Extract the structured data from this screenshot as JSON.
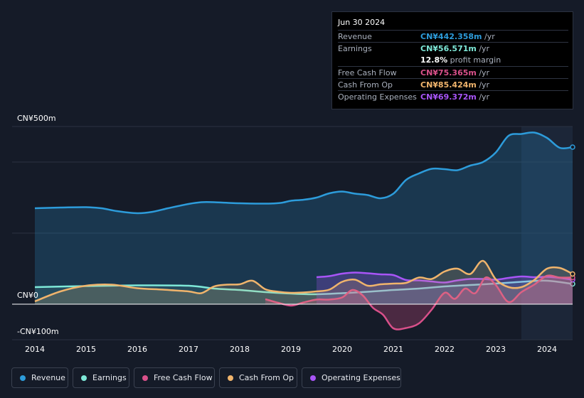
{
  "tooltip": {
    "date": "Jun 30 2024",
    "rows": [
      {
        "label": "Revenue",
        "value": "CN¥442.358m",
        "unit": " /yr",
        "color": "#2d9cdb"
      },
      {
        "label": "Earnings",
        "value": "CN¥56.571m",
        "unit": " /yr",
        "color": "#7ee8d8"
      },
      {
        "label": "",
        "value": "12.8%",
        "unit": " profit margin",
        "color": "#ffffff"
      },
      {
        "label": "Free Cash Flow",
        "value": "CN¥75.365m",
        "unit": " /yr",
        "color": "#d9508a"
      },
      {
        "label": "Cash From Op",
        "value": "CN¥85.424m",
        "unit": " /yr",
        "color": "#f0b46c"
      },
      {
        "label": "Operating Expenses",
        "value": "CN¥69.372m",
        "unit": " /yr",
        "color": "#a855f7"
      }
    ]
  },
  "axis": {
    "y_top_label": "CN¥500m",
    "y_zero_label": "CN¥0",
    "y_bottom_label": "-CN¥100m"
  },
  "legend": [
    {
      "label": "Revenue",
      "color": "#2d9cdb"
    },
    {
      "label": "Earnings",
      "color": "#7ee8d8"
    },
    {
      "label": "Free Cash Flow",
      "color": "#d9508a"
    },
    {
      "label": "Cash From Op",
      "color": "#f0b46c"
    },
    {
      "label": "Operating Expenses",
      "color": "#a855f7"
    }
  ],
  "chart_data": {
    "type": "area",
    "ylim": [
      -100,
      500
    ],
    "xlim": [
      2014.0,
      2024.5
    ],
    "x_ticks": [
      "2014",
      "2015",
      "2016",
      "2017",
      "2018",
      "2019",
      "2020",
      "2021",
      "2022",
      "2023",
      "2024"
    ],
    "highlight_from": 2023.5,
    "series": [
      {
        "name": "Revenue",
        "color": "#2d9cdb",
        "x": [
          2014.0,
          2014.5,
          2015.0,
          2015.3,
          2015.6,
          2016.0,
          2016.3,
          2016.6,
          2017.0,
          2017.25,
          2017.5,
          2018.0,
          2018.5,
          2018.8,
          2019.0,
          2019.25,
          2019.5,
          2019.75,
          2020.0,
          2020.25,
          2020.5,
          2020.75,
          2021.0,
          2021.25,
          2021.5,
          2021.75,
          2022.0,
          2022.25,
          2022.5,
          2022.75,
          2023.0,
          2023.25,
          2023.5,
          2023.75,
          2024.0,
          2024.25,
          2024.5
        ],
        "y": [
          270,
          272,
          273,
          270,
          262,
          256,
          260,
          270,
          282,
          287,
          287,
          284,
          283,
          285,
          291,
          294,
          300,
          312,
          317,
          311,
          307,
          298,
          311,
          350,
          368,
          381,
          380,
          377,
          390,
          400,
          427,
          474,
          479,
          483,
          468,
          440,
          442
        ]
      },
      {
        "name": "Earnings",
        "color": "#7ee8d8",
        "x": [
          2014.0,
          2015.0,
          2016.0,
          2017.0,
          2017.5,
          2018.0,
          2018.5,
          2019.0,
          2019.5,
          2020.0,
          2020.5,
          2021.0,
          2021.5,
          2022.0,
          2022.5,
          2023.0,
          2023.5,
          2024.0,
          2024.5
        ],
        "y": [
          48,
          51,
          53,
          52,
          44,
          40,
          34,
          30,
          28,
          31,
          35,
          40,
          44,
          50,
          54,
          58,
          63,
          66,
          57
        ]
      },
      {
        "name": "Operating Expenses",
        "color": "#a855f7",
        "x": [
          2019.5,
          2019.75,
          2020.0,
          2020.25,
          2020.5,
          2020.75,
          2021.0,
          2021.25,
          2021.5,
          2021.75,
          2022.0,
          2022.25,
          2022.5,
          2022.75,
          2023.0,
          2023.25,
          2023.5,
          2023.75,
          2024.0,
          2024.25,
          2024.5
        ],
        "y": [
          76,
          79,
          86,
          89,
          87,
          84,
          82,
          68,
          67,
          64,
          61,
          67,
          71,
          71,
          69,
          74,
          78,
          76,
          77,
          74,
          69
        ]
      },
      {
        "name": "Free Cash Flow",
        "color": "#d9508a",
        "x": [
          2018.5,
          2018.75,
          2019.0,
          2019.25,
          2019.5,
          2019.75,
          2020.0,
          2020.2,
          2020.4,
          2020.6,
          2020.8,
          2021.0,
          2021.25,
          2021.5,
          2021.75,
          2022.0,
          2022.2,
          2022.4,
          2022.6,
          2022.8,
          2023.0,
          2023.25,
          2023.5,
          2023.75,
          2024.0,
          2024.25,
          2024.5
        ],
        "y": [
          14,
          4,
          -4,
          5,
          13,
          13,
          19,
          40,
          25,
          -10,
          -30,
          -68,
          -67,
          -54,
          -15,
          32,
          15,
          44,
          31,
          75,
          54,
          6,
          34,
          55,
          80,
          75,
          75
        ]
      },
      {
        "name": "Cash From Op",
        "color": "#f0b46c",
        "x": [
          2014.0,
          2014.5,
          2015.0,
          2015.5,
          2016.0,
          2016.5,
          2017.0,
          2017.25,
          2017.5,
          2017.75,
          2018.0,
          2018.25,
          2018.5,
          2018.75,
          2019.0,
          2019.25,
          2019.5,
          2019.75,
          2020.0,
          2020.25,
          2020.5,
          2020.75,
          2021.0,
          2021.25,
          2021.5,
          2021.75,
          2022.0,
          2022.25,
          2022.5,
          2022.75,
          2023.0,
          2023.25,
          2023.5,
          2023.75,
          2024.0,
          2024.25,
          2024.5
        ],
        "y": [
          8,
          36,
          52,
          55,
          45,
          41,
          36,
          31,
          50,
          55,
          56,
          66,
          42,
          35,
          32,
          33,
          36,
          41,
          63,
          69,
          52,
          56,
          58,
          60,
          75,
          71,
          92,
          100,
          85,
          122,
          70,
          48,
          48,
          68,
          100,
          102,
          85
        ]
      }
    ]
  }
}
